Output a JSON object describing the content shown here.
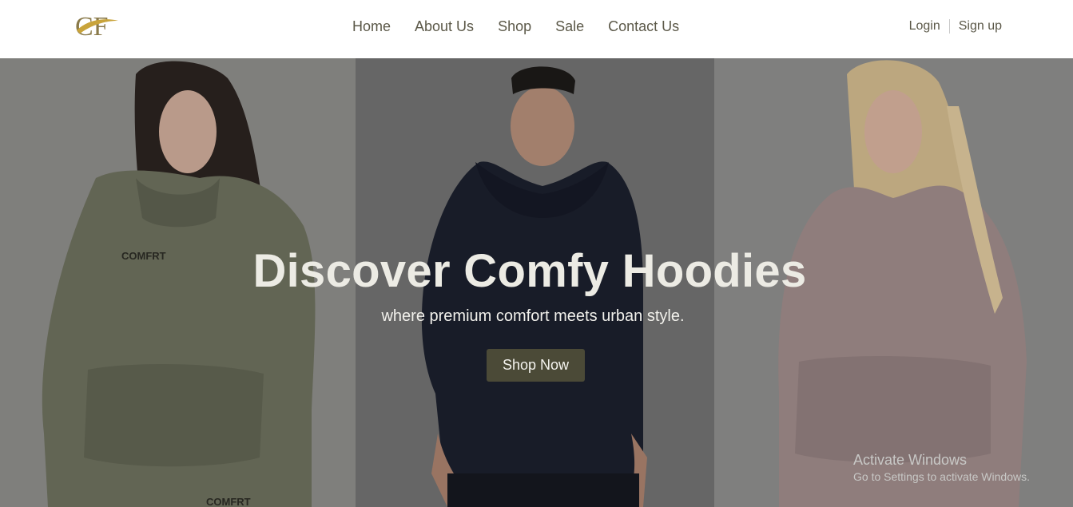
{
  "brand": {
    "logo_text": "CF"
  },
  "nav": {
    "links": [
      {
        "label": "Home"
      },
      {
        "label": "About Us"
      },
      {
        "label": "Shop"
      },
      {
        "label": "Sale"
      },
      {
        "label": "Contact Us"
      }
    ],
    "login_label": "Login",
    "signup_label": "Sign up"
  },
  "hero": {
    "title": "Discover Comfy Hoodies",
    "subtitle": "where premium comfort meets urban style.",
    "cta_label": "Shop Now",
    "images": [
      {
        "name": "woman-olive-hoodie",
        "print": "COMFRT"
      },
      {
        "name": "man-navy-hoodie"
      },
      {
        "name": "woman-mauve-hoodie"
      }
    ]
  },
  "os_watermark": {
    "title": "Activate Windows",
    "subtitle": "Go to Settings to activate Windows."
  },
  "colors": {
    "nav_text": "#5b5848",
    "cta_bg": "#4b4a37",
    "hero_text": "#ecebe4"
  }
}
